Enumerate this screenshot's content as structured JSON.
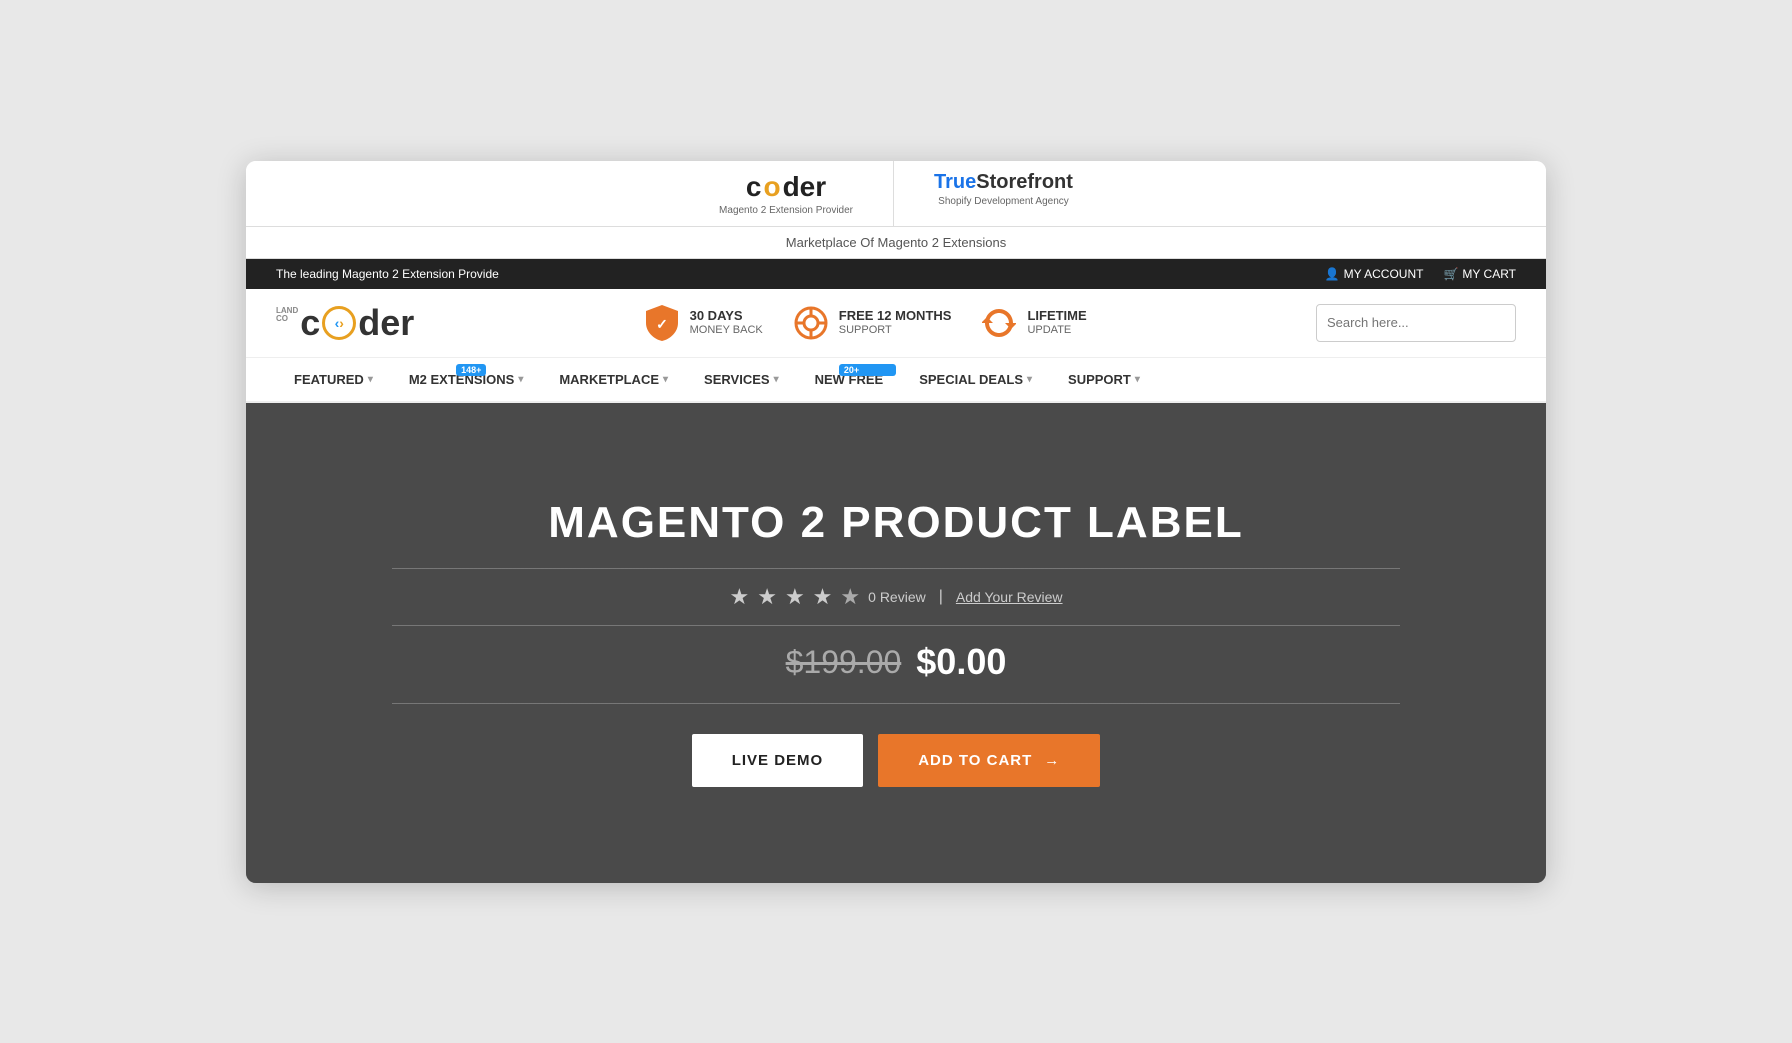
{
  "browser": {
    "top_brands": [
      {
        "name": "coder",
        "subtitle": "Magento 2 Extension Provider",
        "active": true
      },
      {
        "name": "TrueStorefront",
        "subtitle": "Shopify Development Agency",
        "active": false
      }
    ]
  },
  "marketplace_bar": {
    "text": "Marketplace Of Magento 2 Extensions"
  },
  "top_bar": {
    "tagline": "The leading Magento 2 Extension Provide",
    "my_account": "MY ACCOUNT",
    "my_cart": "MY CART"
  },
  "header": {
    "logo": "coder",
    "logo_tagline": "LAND CO",
    "features": [
      {
        "id": "money-back",
        "title": "30 DAYS",
        "subtitle": "MONEY BACK",
        "icon": "shield"
      },
      {
        "id": "support",
        "title": "FREE 12 MONTHS",
        "subtitle": "SUPPORT",
        "icon": "lifebuoy"
      },
      {
        "id": "update",
        "title": "LIFETIME",
        "subtitle": "UPDATE",
        "icon": "refresh"
      }
    ],
    "search_placeholder": "Search here..."
  },
  "nav": {
    "items": [
      {
        "label": "FEATURED",
        "has_dropdown": true,
        "badge": null
      },
      {
        "label": "M2 EXTENSIONS",
        "has_dropdown": true,
        "badge": "148+"
      },
      {
        "label": "MARKETPLACE",
        "has_dropdown": true,
        "badge": null
      },
      {
        "label": "SERVICES",
        "has_dropdown": true,
        "badge": null
      },
      {
        "label": "NEW FREE",
        "has_dropdown": false,
        "badge": "20+"
      },
      {
        "label": "SPECIAL DEALS",
        "has_dropdown": true,
        "badge": null
      },
      {
        "label": "SUPPORT",
        "has_dropdown": true,
        "badge": null
      }
    ]
  },
  "hero": {
    "title": "MAGENTO 2 PRODUCT LABEL",
    "stars": 4,
    "max_stars": 5,
    "review_count": "0 Review",
    "add_review": "Add Your Review",
    "original_price": "$199.00",
    "current_price": "$0.00",
    "btn_demo": "LIVE DEMO",
    "btn_cart": "ADD TO CART",
    "btn_cart_arrow": "→"
  }
}
